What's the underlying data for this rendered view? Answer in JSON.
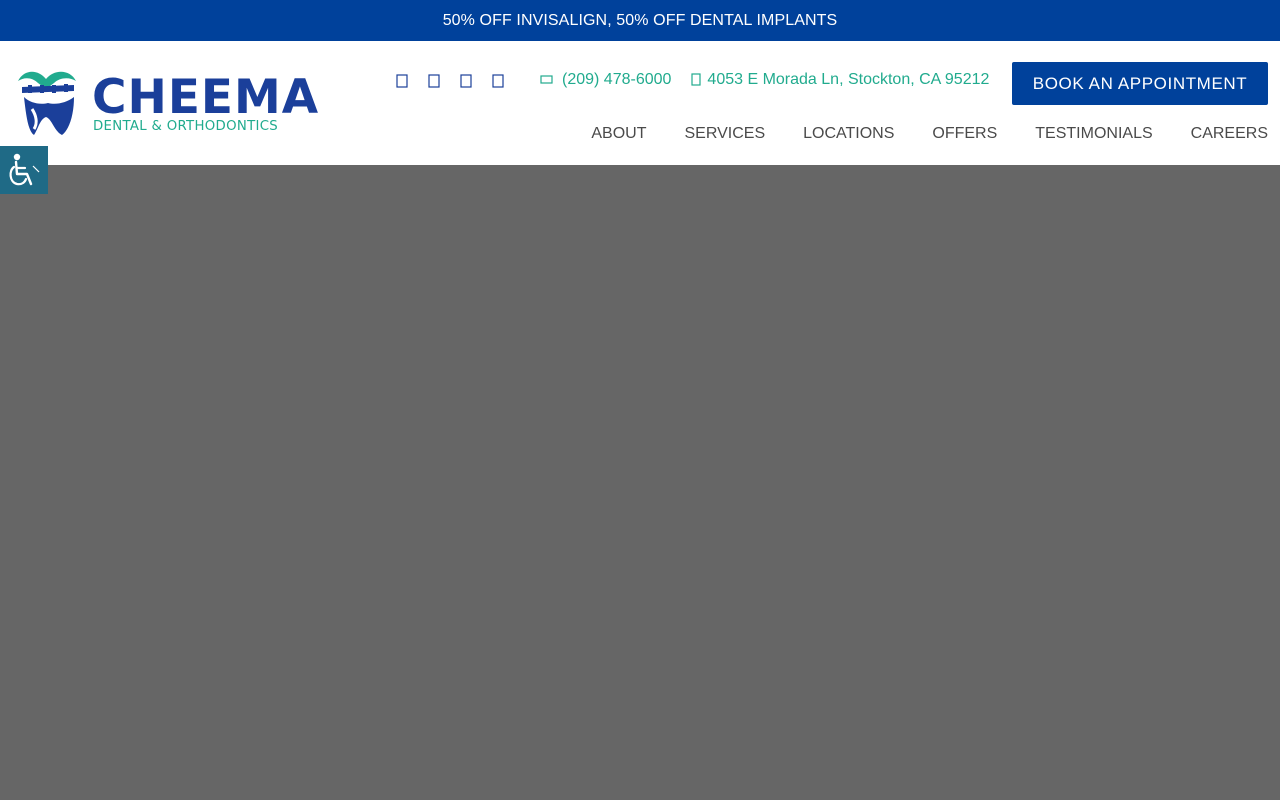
{
  "promo": {
    "text": "50% OFF INVISALIGN, 50% OFF DENTAL IMPLANTS"
  },
  "logo": {
    "wordmark": "CHEEMA",
    "tagline": "DENTAL & ORTHODONTICS"
  },
  "social": {
    "icons": [
      "facebook-icon",
      "instagram-icon",
      "google-icon",
      "yelp-icon"
    ]
  },
  "contact": {
    "phone": "(209) 478-6000",
    "address": "4053 E Morada Ln, Stockton, CA 95212"
  },
  "cta": {
    "label": "BOOK AN APPOINTMENT"
  },
  "nav": {
    "items": [
      "ABOUT",
      "SERVICES",
      "LOCATIONS",
      "OFFERS",
      "TESTIMONIALS",
      "CAREERS"
    ]
  },
  "colors": {
    "brand_blue": "#00419b",
    "brand_green": "#21ab8e",
    "hero_bg": "#666666",
    "a11y_bg": "#1f6a86"
  }
}
